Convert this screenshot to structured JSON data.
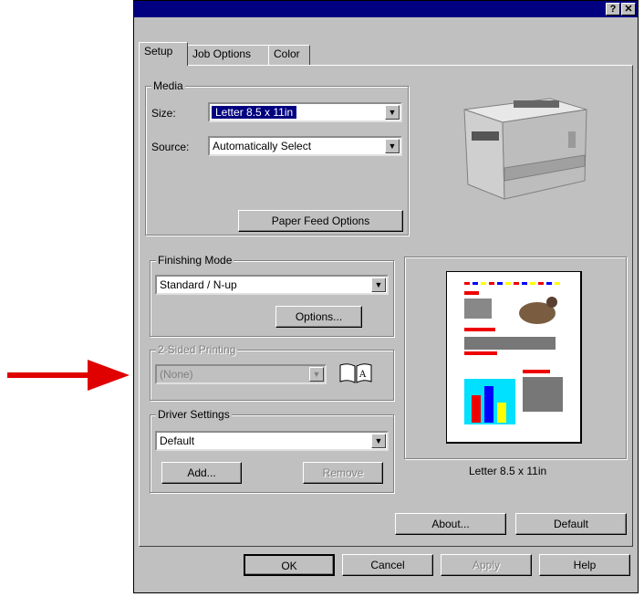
{
  "titlebar": {
    "help_label": "?",
    "close_label": "✕"
  },
  "tabs": [
    {
      "label": "Setup"
    },
    {
      "label": "Job Options"
    },
    {
      "label": "Color"
    }
  ],
  "media": {
    "group_label": "Media",
    "size_label": "Size:",
    "size_value": "Letter 8.5 x 11in",
    "source_label": "Source:",
    "source_value": "Automatically Select",
    "paper_feed_button": "Paper Feed Options"
  },
  "finishing": {
    "group_label": "Finishing Mode",
    "value": "Standard / N-up",
    "options_button": "Options..."
  },
  "two_sided": {
    "group_label": "2-Sided Printing",
    "value": "(None)"
  },
  "driver": {
    "group_label": "Driver Settings",
    "value": "Default",
    "add_button": "Add...",
    "remove_button": "Remove"
  },
  "preview": {
    "caption": "Letter 8.5 x 11in"
  },
  "about_button": "About...",
  "default_button": "Default",
  "footer": {
    "ok": "OK",
    "cancel": "Cancel",
    "apply": "Apply",
    "help": "Help"
  },
  "colors": {
    "accent": "#000080",
    "dialog": "#c0c0c0",
    "arrow": "#e00000"
  }
}
